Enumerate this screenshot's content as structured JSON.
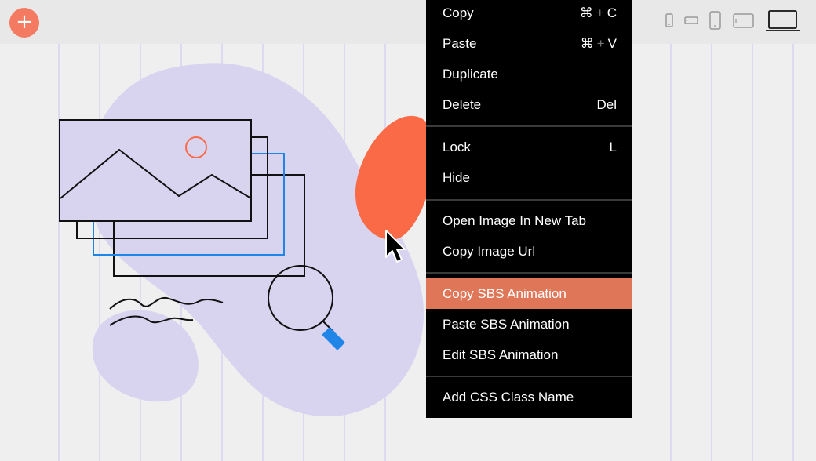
{
  "toolbar": {
    "add_label": "+",
    "devices": [
      "mobile-portrait",
      "mobile-landscape",
      "tablet-portrait",
      "tablet-landscape",
      "desktop"
    ],
    "active_device": "desktop"
  },
  "context_menu": {
    "groups": [
      [
        {
          "label": "Copy",
          "shortcut_key": "⌘",
          "shortcut_plus": "+",
          "shortcut_char": "C"
        },
        {
          "label": "Paste",
          "shortcut_key": "⌘",
          "shortcut_plus": "+",
          "shortcut_char": "V"
        },
        {
          "label": "Duplicate"
        },
        {
          "label": "Delete",
          "shortcut": "Del"
        }
      ],
      [
        {
          "label": "Lock",
          "shortcut": "L"
        },
        {
          "label": "Hide"
        }
      ],
      [
        {
          "label": "Open Image In New Tab"
        },
        {
          "label": "Copy Image Url"
        }
      ],
      [
        {
          "label": "Copy SBS Animation",
          "highlighted": true
        },
        {
          "label": "Paste SBS Animation"
        },
        {
          "label": "Edit SBS Animation"
        }
      ],
      [
        {
          "label": "Add CSS Class Name"
        }
      ]
    ]
  },
  "colors": {
    "accent": "#f47a62",
    "highlight": "#e07658",
    "blob_purple": "#d8d4f0",
    "blob_orange": "#fa6a47",
    "blue": "#1f86e8",
    "menu_bg": "#000000"
  },
  "icons": [
    "plus-icon",
    "mobile-portrait-icon",
    "mobile-landscape-icon",
    "tablet-portrait-icon",
    "tablet-landscape-icon",
    "desktop-icon",
    "mouse-cursor-icon",
    "image-stack-illustration",
    "magnifier-illustration"
  ]
}
